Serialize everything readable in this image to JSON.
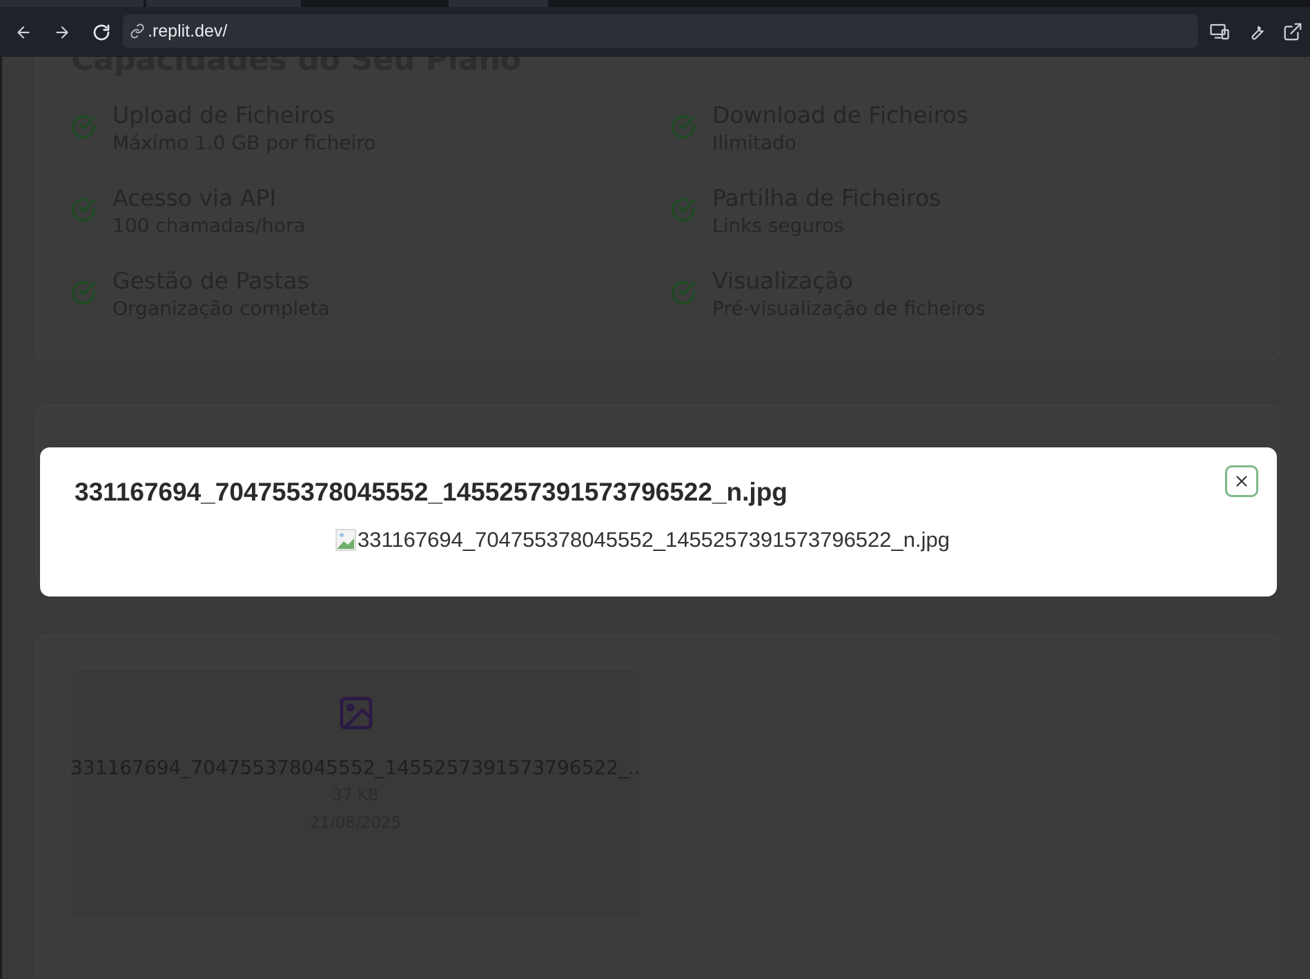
{
  "browser": {
    "url": ".replit.dev/"
  },
  "capabilities": {
    "title": "Capacidades do Seu Plano",
    "features": [
      {
        "title": "Upload de Ficheiros",
        "desc": "Máximo 1.0 GB por ficheiro"
      },
      {
        "title": "Download de Ficheiros",
        "desc": "Ilimitado"
      },
      {
        "title": "Acesso via API",
        "desc": "100 chamadas/hora"
      },
      {
        "title": "Partilha de Ficheiros",
        "desc": "Links seguros"
      },
      {
        "title": "Gestão de Pastas",
        "desc": "Organização completa"
      },
      {
        "title": "Visualização",
        "desc": "Pré-visualização de ficheiros"
      }
    ]
  },
  "files": [
    {
      "name": "331167694_704755378045552_1455257391573796522_...",
      "size": "37 KB",
      "date": "21/08/2025"
    }
  ],
  "modal": {
    "title": "331167694_704755378045552_1455257391573796522_n.jpg",
    "image_alt": "331167694_704755378045552_1455257391573796522_n.jpg"
  },
  "colors": {
    "check": "#1f4a24",
    "file_icon": "#2a1a45",
    "close_border": "#7fb98a"
  }
}
